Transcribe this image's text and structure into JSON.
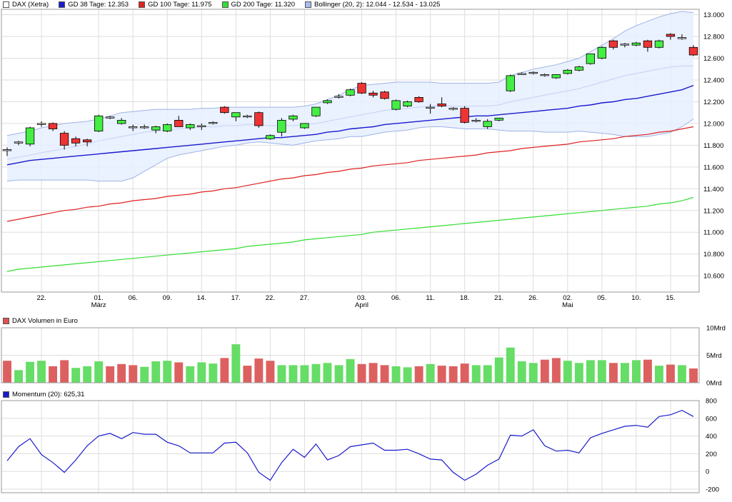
{
  "price_legend": [
    {
      "label": "DAX (Xetra)",
      "color": "#ffffff"
    },
    {
      "label": "GD 38 Tage: 12.353",
      "color": "#1a1acc"
    },
    {
      "label": "GD 100 Tage: 11.975",
      "color": "#e02020"
    },
    {
      "label": "GD 200 Tage: 11.320",
      "color": "#33dd33"
    },
    {
      "label": "Bollinger (20, 2): 12.044 - 12.534 - 13.025",
      "color": "#aabbee"
    }
  ],
  "volume_legend": [
    {
      "label": "DAX Volumen in Euro",
      "color": "#e05050"
    }
  ],
  "momentum_legend": [
    {
      "label": "Momentum (20): 625,31",
      "color": "#1a1acc"
    }
  ],
  "colors": {
    "up": "#44ee44",
    "down": "#ee3333",
    "vol_up": "#66dd66",
    "vol_down": "#dd6060",
    "band_fill": "#e6eeff",
    "band_line": "#9fb4e4",
    "grid": "#dddddd"
  },
  "chart_data": [
    {
      "type": "candlestick",
      "x_tick_labels": [
        {
          "label": "22.",
          "sub": "",
          "i": 3
        },
        {
          "label": "01.",
          "sub": "März",
          "i": 8
        },
        {
          "label": "06.",
          "sub": "",
          "i": 11
        },
        {
          "label": "09.",
          "sub": "",
          "i": 14
        },
        {
          "label": "14.",
          "sub": "",
          "i": 17
        },
        {
          "label": "17.",
          "sub": "",
          "i": 20
        },
        {
          "label": "22.",
          "sub": "",
          "i": 23
        },
        {
          "label": "27.",
          "sub": "",
          "i": 26
        },
        {
          "label": "03.",
          "sub": "April",
          "i": 31
        },
        {
          "label": "06.",
          "sub": "",
          "i": 34
        },
        {
          "label": "11.",
          "sub": "",
          "i": 37
        },
        {
          "label": "18.",
          "sub": "",
          "i": 40
        },
        {
          "label": "21.",
          "sub": "",
          "i": 43
        },
        {
          "label": "26.",
          "sub": "",
          "i": 46
        },
        {
          "label": "02.",
          "sub": "Mai",
          "i": 49
        },
        {
          "label": "05.",
          "sub": "",
          "i": 52
        },
        {
          "label": "10.",
          "sub": "",
          "i": 55
        },
        {
          "label": "15.",
          "sub": "",
          "i": 58
        }
      ],
      "y_ticks": [
        "10.600",
        "10.800",
        "11.000",
        "11.200",
        "11.400",
        "11.600",
        "11.800",
        "12.000",
        "12.200",
        "12.400",
        "12.600",
        "12.800",
        "13.000"
      ],
      "ylim": [
        10.45,
        13.05
      ],
      "ohlc": [
        [
          11.75,
          11.78,
          11.7,
          11.76
        ],
        [
          11.82,
          11.84,
          11.8,
          11.83
        ],
        [
          11.81,
          11.97,
          11.79,
          11.96
        ],
        [
          11.99,
          12.02,
          11.97,
          12.0
        ],
        [
          12.0,
          12.01,
          11.93,
          11.95
        ],
        [
          11.91,
          11.93,
          11.76,
          11.8
        ],
        [
          11.86,
          11.88,
          11.79,
          11.82
        ],
        [
          11.85,
          11.86,
          11.79,
          11.83
        ],
        [
          11.93,
          12.08,
          11.92,
          12.07
        ],
        [
          12.06,
          12.07,
          12.04,
          12.05
        ],
        [
          12.0,
          12.05,
          11.99,
          12.03
        ],
        [
          11.97,
          11.99,
          11.93,
          11.96
        ],
        [
          11.97,
          11.99,
          11.95,
          11.97
        ],
        [
          11.94,
          11.98,
          11.91,
          11.97
        ],
        [
          11.93,
          12.0,
          11.92,
          11.99
        ],
        [
          12.03,
          12.07,
          11.97,
          11.97
        ],
        [
          11.96,
          12.0,
          11.94,
          11.99
        ],
        [
          11.98,
          12.0,
          11.94,
          11.98
        ],
        [
          12.0,
          12.02,
          11.99,
          12.01
        ],
        [
          12.15,
          12.16,
          12.09,
          12.1
        ],
        [
          12.06,
          12.1,
          12.02,
          12.1
        ],
        [
          12.07,
          12.08,
          12.05,
          12.06
        ],
        [
          12.1,
          12.11,
          11.96,
          11.98
        ],
        [
          11.86,
          11.9,
          11.85,
          11.89
        ],
        [
          11.92,
          12.05,
          11.88,
          12.03
        ],
        [
          12.04,
          12.08,
          12.02,
          12.07
        ],
        [
          11.96,
          12.0,
          11.95,
          12.0
        ],
        [
          12.07,
          12.15,
          12.06,
          12.15
        ],
        [
          12.19,
          12.22,
          12.18,
          12.21
        ],
        [
          12.24,
          12.27,
          12.23,
          12.25
        ],
        [
          12.26,
          12.32,
          12.25,
          12.31
        ],
        [
          12.37,
          12.38,
          12.27,
          12.28
        ],
        [
          12.28,
          12.3,
          12.24,
          12.26
        ],
        [
          12.29,
          12.3,
          12.22,
          12.23
        ],
        [
          12.13,
          12.22,
          12.12,
          12.21
        ],
        [
          12.16,
          12.21,
          12.15,
          12.2
        ],
        [
          12.24,
          12.25,
          12.19,
          12.2
        ],
        [
          12.15,
          12.18,
          12.09,
          12.15
        ],
        [
          12.18,
          12.24,
          12.15,
          12.16
        ],
        [
          12.14,
          12.15,
          12.12,
          12.13
        ],
        [
          12.14,
          12.16,
          12.0,
          12.01
        ],
        [
          12.03,
          12.05,
          12.01,
          12.03
        ],
        [
          11.97,
          12.04,
          11.95,
          12.02
        ],
        [
          12.03,
          12.05,
          12.02,
          12.05
        ],
        [
          12.3,
          12.45,
          12.29,
          12.44
        ],
        [
          12.46,
          12.47,
          12.45,
          12.46
        ],
        [
          12.47,
          12.48,
          12.45,
          12.47
        ],
        [
          12.45,
          12.46,
          12.43,
          12.44
        ],
        [
          12.42,
          12.45,
          12.41,
          12.45
        ],
        [
          12.46,
          12.5,
          12.45,
          12.49
        ],
        [
          12.49,
          12.53,
          12.48,
          12.52
        ],
        [
          12.55,
          12.64,
          12.54,
          12.64
        ],
        [
          12.6,
          12.71,
          12.59,
          12.7
        ],
        [
          12.76,
          12.77,
          12.68,
          12.7
        ],
        [
          12.72,
          12.74,
          12.7,
          12.73
        ],
        [
          12.72,
          12.75,
          12.71,
          12.74
        ],
        [
          12.76,
          12.77,
          12.66,
          12.7
        ],
        [
          12.7,
          12.77,
          12.69,
          12.76
        ],
        [
          12.82,
          12.83,
          12.77,
          12.8
        ],
        [
          12.78,
          12.82,
          12.77,
          12.79
        ],
        [
          12.7,
          12.72,
          12.62,
          12.63
        ]
      ],
      "gd38": [
        11.62,
        11.64,
        11.66,
        11.67,
        11.68,
        11.69,
        11.7,
        11.71,
        11.72,
        11.73,
        11.74,
        11.75,
        11.76,
        11.77,
        11.78,
        11.79,
        11.8,
        11.81,
        11.82,
        11.83,
        11.84,
        11.85,
        11.86,
        11.87,
        11.87,
        11.88,
        11.89,
        11.9,
        11.92,
        11.93,
        11.95,
        11.96,
        11.97,
        11.99,
        12.0,
        12.01,
        12.02,
        12.03,
        12.04,
        12.05,
        12.06,
        12.07,
        12.07,
        12.08,
        12.09,
        12.1,
        12.11,
        12.12,
        12.13,
        12.14,
        12.16,
        12.17,
        12.19,
        12.2,
        12.22,
        12.23,
        12.25,
        12.27,
        12.29,
        12.31,
        12.35
      ],
      "gd100": [
        11.1,
        11.12,
        11.14,
        11.16,
        11.18,
        11.2,
        11.21,
        11.23,
        11.24,
        11.26,
        11.27,
        11.29,
        11.3,
        11.31,
        11.33,
        11.34,
        11.35,
        11.37,
        11.38,
        11.4,
        11.41,
        11.43,
        11.45,
        11.47,
        11.49,
        11.5,
        11.52,
        11.53,
        11.55,
        11.56,
        11.58,
        11.59,
        11.61,
        11.62,
        11.63,
        11.64,
        11.66,
        11.67,
        11.68,
        11.69,
        11.7,
        11.71,
        11.73,
        11.74,
        11.75,
        11.77,
        11.78,
        11.79,
        11.8,
        11.81,
        11.83,
        11.84,
        11.85,
        11.86,
        11.88,
        11.89,
        11.9,
        11.92,
        11.93,
        11.95,
        11.97
      ],
      "gd200": [
        10.64,
        10.66,
        10.67,
        10.68,
        10.69,
        10.7,
        10.71,
        10.72,
        10.73,
        10.74,
        10.75,
        10.76,
        10.77,
        10.78,
        10.79,
        10.8,
        10.81,
        10.82,
        10.83,
        10.84,
        10.85,
        10.87,
        10.88,
        10.89,
        10.9,
        10.91,
        10.93,
        10.94,
        10.95,
        10.96,
        10.97,
        10.98,
        11.0,
        11.01,
        11.02,
        11.03,
        11.04,
        11.05,
        11.06,
        11.07,
        11.08,
        11.09,
        11.1,
        11.11,
        11.12,
        11.13,
        11.14,
        11.15,
        11.16,
        11.17,
        11.18,
        11.19,
        11.2,
        11.21,
        11.22,
        11.23,
        11.24,
        11.26,
        11.27,
        11.29,
        11.32
      ],
      "boll_upper": [
        11.89,
        11.91,
        11.93,
        11.96,
        11.98,
        12.0,
        12.01,
        12.02,
        12.04,
        12.07,
        12.1,
        12.11,
        12.12,
        12.13,
        12.13,
        12.13,
        12.13,
        12.14,
        12.14,
        12.15,
        12.15,
        12.15,
        12.15,
        12.15,
        12.15,
        12.15,
        12.16,
        12.18,
        12.22,
        12.26,
        12.31,
        12.35,
        12.36,
        12.37,
        12.38,
        12.38,
        12.38,
        12.38,
        12.37,
        12.37,
        12.37,
        12.37,
        12.37,
        12.38,
        12.44,
        12.47,
        12.5,
        12.52,
        12.54,
        12.57,
        12.6,
        12.66,
        12.72,
        12.78,
        12.85,
        12.9,
        12.94,
        12.98,
        13.01,
        13.03,
        13.02
      ],
      "boll_mid": [
        11.67,
        11.69,
        11.71,
        11.73,
        11.75,
        11.77,
        11.79,
        11.81,
        11.84,
        11.86,
        11.88,
        11.9,
        11.92,
        11.93,
        11.94,
        11.95,
        11.96,
        11.97,
        11.97,
        11.98,
        11.98,
        11.99,
        11.99,
        11.98,
        11.98,
        11.98,
        11.99,
        12.0,
        12.02,
        12.04,
        12.06,
        12.08,
        12.1,
        12.12,
        12.13,
        12.14,
        12.15,
        12.16,
        12.16,
        12.16,
        12.16,
        12.16,
        12.16,
        12.17,
        12.2,
        12.22,
        12.24,
        12.26,
        12.28,
        12.3,
        12.32,
        12.35,
        12.38,
        12.41,
        12.44,
        12.46,
        12.48,
        12.5,
        12.52,
        12.53,
        12.53
      ],
      "boll_lower": [
        11.47,
        11.48,
        11.48,
        11.48,
        11.48,
        11.48,
        11.48,
        11.48,
        11.47,
        11.47,
        11.47,
        11.5,
        11.56,
        11.62,
        11.68,
        11.71,
        11.73,
        11.75,
        11.77,
        11.79,
        11.8,
        11.82,
        11.83,
        11.82,
        11.81,
        11.8,
        11.82,
        11.84,
        11.85,
        11.86,
        11.88,
        11.88,
        11.9,
        11.92,
        11.93,
        11.94,
        11.96,
        11.97,
        11.97,
        11.96,
        11.95,
        11.95,
        11.95,
        11.94,
        11.93,
        11.93,
        11.93,
        11.92,
        11.92,
        11.92,
        11.93,
        11.92,
        11.91,
        11.9,
        11.88,
        11.88,
        11.88,
        11.9,
        11.92,
        11.97,
        12.04
      ]
    },
    {
      "type": "bar",
      "y_ticks": [
        "0Mrd",
        "5Mrd",
        "10Mrd"
      ],
      "ylim": [
        0,
        10
      ],
      "values": [
        4.0,
        2.3,
        3.8,
        4.0,
        3.0,
        4.1,
        2.7,
        3.0,
        3.9,
        3.0,
        3.4,
        3.2,
        2.9,
        3.9,
        4.0,
        3.7,
        3.0,
        3.7,
        3.5,
        4.5,
        7.0,
        3.1,
        4.4,
        4.0,
        3.2,
        3.2,
        3.2,
        3.4,
        3.6,
        3.2,
        4.3,
        3.4,
        3.6,
        3.2,
        3.0,
        2.8,
        3.0,
        3.4,
        3.1,
        3.0,
        3.5,
        3.2,
        3.2,
        4.6,
        6.4,
        3.9,
        3.6,
        4.2,
        4.5,
        4.0,
        3.6,
        4.1,
        4.1,
        3.6,
        3.6,
        4.1,
        4.2,
        3.1,
        3.3,
        3.2,
        2.6
      ],
      "up": [
        false,
        true,
        true,
        true,
        false,
        false,
        true,
        true,
        true,
        false,
        false,
        false,
        true,
        true,
        true,
        false,
        true,
        true,
        true,
        false,
        true,
        false,
        false,
        false,
        true,
        true,
        true,
        true,
        true,
        true,
        true,
        false,
        false,
        false,
        true,
        true,
        false,
        true,
        false,
        false,
        false,
        true,
        true,
        true,
        true,
        true,
        true,
        false,
        false,
        true,
        true,
        true,
        true,
        false,
        true,
        true,
        false,
        true,
        false,
        true,
        false
      ]
    },
    {
      "type": "line",
      "y_ticks": [
        "-200",
        "0",
        "200",
        "400",
        "600",
        "800"
      ],
      "ylim": [
        -240,
        800
      ],
      "values": [
        120,
        280,
        370,
        190,
        100,
        -10,
        130,
        290,
        400,
        430,
        370,
        440,
        420,
        420,
        330,
        290,
        210,
        210,
        210,
        320,
        330,
        210,
        -10,
        -100,
        100,
        250,
        160,
        310,
        130,
        180,
        280,
        300,
        320,
        240,
        240,
        250,
        200,
        140,
        130,
        -10,
        -100,
        -30,
        70,
        140,
        410,
        400,
        470,
        290,
        230,
        240,
        210,
        380,
        430,
        470,
        510,
        520,
        500,
        620,
        640,
        690,
        620
      ]
    }
  ]
}
